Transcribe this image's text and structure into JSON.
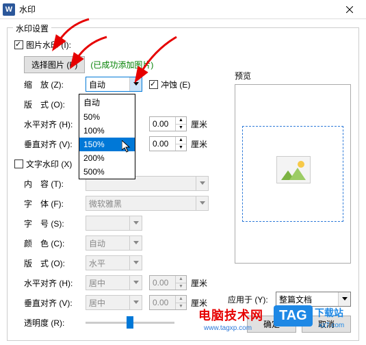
{
  "title": "水印",
  "group_legend": "水印设置",
  "pic_watermark": {
    "label": "图片水印 (I):",
    "checked": true
  },
  "select_pic_btn": "选择图片 (P)",
  "success_msg": "(已成功添加图片)",
  "zoom": {
    "label": "缩　放 (Z):",
    "value": "自动"
  },
  "erode": {
    "label": "冲蚀 (E)",
    "checked": true
  },
  "layout1": {
    "label": "版　式 (O):"
  },
  "halign1": {
    "label": "水平对齐 (H):",
    "num": "0.00",
    "unit": "厘米"
  },
  "valign1": {
    "label": "垂直对齐 (V):",
    "num": "0.00",
    "unit": "厘米"
  },
  "text_watermark": {
    "label": "文字水印 (X)",
    "checked": false
  },
  "content_row": {
    "label": "内　容 (T):"
  },
  "font_row": {
    "label": "字　体 (F):",
    "value": "微软雅黑"
  },
  "size_row": {
    "label": "字　号 (S):"
  },
  "color_row": {
    "label": "颜　色 (C):",
    "value": "自动"
  },
  "layout2": {
    "label": "版　式 (O):",
    "value": "水平"
  },
  "halign2": {
    "label": "水平对齐 (H):",
    "value": "居中",
    "num": "0.00",
    "unit": "厘米"
  },
  "valign2": {
    "label": "垂直对齐 (V):",
    "value": "居中",
    "num": "0.00",
    "unit": "厘米"
  },
  "opacity": {
    "label": "透明度 (R):"
  },
  "preview_label": "预览",
  "apply_to": {
    "label": "应用于 (Y):",
    "value": "整篇文档"
  },
  "ok_btn": "确定",
  "cancel_btn": "取消",
  "dropdown_options": [
    "自动",
    "50%",
    "100%",
    "150%",
    "200%",
    "500%"
  ],
  "dropdown_hover_index": 3,
  "overlay": {
    "red_text": "电脑技术网",
    "blue_text": "www.tagxp.com",
    "tag": "TAG",
    "dl_text": "下载站",
    "dl_url": "xz7.com"
  }
}
